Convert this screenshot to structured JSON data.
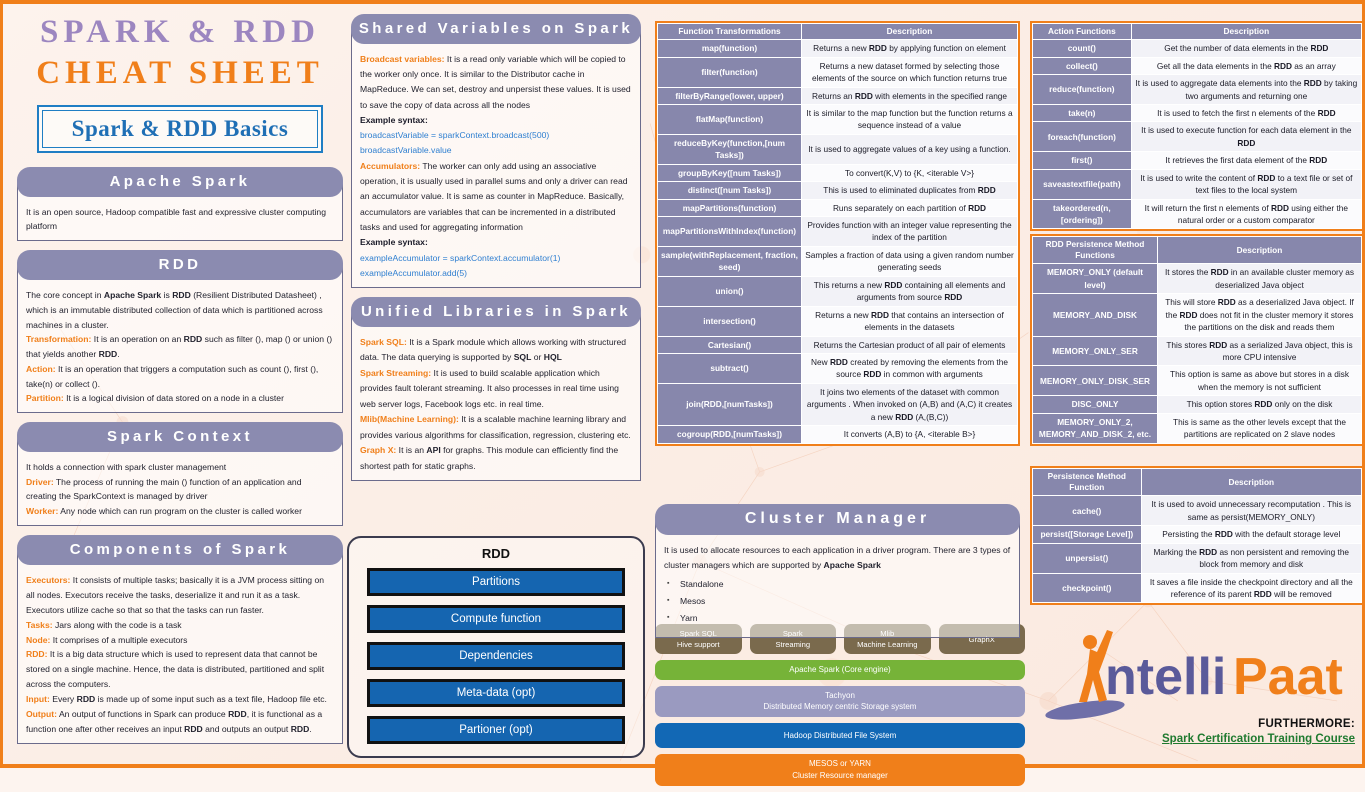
{
  "title": {
    "line1": "SPARK & RDD",
    "line2": "CHEAT SHEET",
    "badge": "Spark & RDD Basics"
  },
  "colors": {
    "accent_orange": "#F07F1A",
    "header_purple": "#8b8bb0",
    "title_purple": "#9c86c0",
    "badge_blue": "#1f6fb5",
    "bar_blue": "#1565b0"
  },
  "left": {
    "apache_spark": {
      "heading": "Apache Spark",
      "body": [
        {
          "text": "It is an open source, Hadoop compatible  fast and expressive cluster computing platform"
        }
      ]
    },
    "rdd": {
      "heading": "RDD",
      "body": [
        {
          "lead": "",
          "text": "The core concept in Apache Spark  is RDD (Resilient Distributed Datasheet) , which is an immutable  distributed collection of data which is partitioned across machines in a cluster."
        },
        {
          "lead": "Transformation:",
          "text": "  It is an operation  on an RDD such as filter (), map () or union () that yields another RDD."
        },
        {
          "lead": "Action:",
          "text": " It is an operation  that triggers a computation  such as count (), first (), take(n) or collect ()."
        },
        {
          "lead": "Partition:",
          "text": " It is a logical division of data stored on a node in a cluster"
        }
      ]
    },
    "spark_context": {
      "heading": "Spark Context",
      "body": [
        {
          "lead": "",
          "text": "It holds a connection with spark cluster management"
        },
        {
          "lead": "Driver:",
          "text": " The process of running the main () function of an application  and creating the SparkContext  is managed  by driver"
        },
        {
          "lead": "Worker:",
          "text": " Any node which can run program  on the cluster is called worker"
        }
      ]
    },
    "components": {
      "heading": "Components of Spark",
      "body": [
        {
          "lead": "Executors:",
          "text": " It consists of multiple  tasks; basically  it is a JVM process sitting on all nodes. Executors receive  the tasks, deserialize  it and run it as a task. Executors utilize  cache so that  so that  the tasks can run faster."
        },
        {
          "lead": "Tasks:",
          "text": " Jars along  with the code  is a task"
        },
        {
          "lead": "Node:",
          "text": " It comprises  of a multiple  executors"
        },
        {
          "lead": "RDD:",
          "text": " It is a big data  structure  which is used to represent data that cannot  be stored on a single machine.  Hence, the data  is distributed, partitioned  and split across  the computers."
        },
        {
          "lead": "Input:",
          "text": " Every RDD is made  up of some input such as  a text file, Hadoop  file etc."
        },
        {
          "lead": "Output:",
          "text": " An output  of functions in Spark  can produce  RDD, it is functional  as a function one after other receives an input RDD and outputs an output RDD."
        }
      ]
    }
  },
  "middle": {
    "shared_variables": {
      "heading": "Shared Variables on Spark",
      "body": [
        {
          "lead": "Broadcast  variables:",
          "text": "  It is a read only variable  which will be copied to the worker only once. It is similar  to the Distributor  cache in MapReduce. We can set, destroy and unpersist these values. It is used to save  the copy of data  across all the nodes"
        },
        {
          "bold": "Example  syntax:"
        },
        {
          "code": "broadcastVariable   = sparkContext.broadcast(500)"
        },
        {
          "code": "broadcastVariable.value"
        },
        {
          "lead": "Accumulators:",
          "text": " The worker can only add using an associative  operation, it is usually used in parallel sums and only a driver can read an accumulator value. It is same as counter in MapReduce. Basically,  accumulators  are variables  that can be incremented in a distributed tasks and used for aggregating  information"
        },
        {
          "bold": "Example  syntax:"
        },
        {
          "code": "exampleAccumulator   = sparkContext.accumulator(1)"
        },
        {
          "code": "exampleAccumulator.add(5)"
        }
      ]
    },
    "unified_libraries": {
      "heading": "Unified Libraries in Spark",
      "body": [
        {
          "lead": "Spark  SQL:",
          "text": " It is a Spark  module  which allows working with structured data.  The data querying  is supported by SQL or HQL"
        },
        {
          "lead": "Spark  Streaming:",
          "text": "  It is used to build scalable application  which provides fault tolerant  streaming.  It also processes in real time using web server logs, Facebook  logs etc. in real time."
        },
        {
          "lead": "Mlib(Machine  Learning):",
          "text": "  It is a scalable machine learning library and provides various algorithms  for classification, regression, clustering etc."
        },
        {
          "lead": "Graph X:",
          "text": " It is an API for graphs. This module  can efficiently find the shortest path for static graphs."
        }
      ]
    },
    "rdd_diagram": {
      "title": "RDD",
      "bars": [
        "Partitions",
        "Compute function",
        "Dependencies",
        "Meta-data (opt)",
        "Partioner (opt)"
      ]
    }
  },
  "transformations": {
    "headers": [
      "Function Transformations",
      "Description"
    ],
    "rows": [
      [
        "map(function)",
        "Returns a new RDD by applying function on element"
      ],
      [
        "filter(function)",
        "Returns a new dataset formed by selecting those elements  of the source on which function returns true"
      ],
      [
        "filterByRange(lower,  upper)",
        "Returns an RDD with elements  in the specified range"
      ],
      [
        "flatMap(function)",
        "It is similar to the map function but the function returns a sequence instead of a value"
      ],
      [
        "reduceByKey(function,[num Tasks])",
        "It is used to aggregate  values of a key using a function."
      ],
      [
        "groupByKey([num Tasks])",
        "To convert(K,V) to {K, <iterable  V>}"
      ],
      [
        "distinct([num Tasks])",
        "This is used to eliminated  duplicates from RDD"
      ],
      [
        "mapPartitions(function)",
        "Runs separately on each partition of RDD"
      ],
      [
        "mapPartitionsWithIndex(function)",
        "Provides function with an integer value representing the index of the partition"
      ],
      [
        "sample(withReplacement, fraction,  seed)",
        "Samples  a fraction of data using a given random number generating  seeds"
      ],
      [
        "union()",
        "This returns a new RDD containing all elements  and arguments  from source RDD"
      ],
      [
        "intersection()",
        "Returns a new RDD that contains an intersection of elements  in the datasets"
      ],
      [
        "Cartesian()",
        "Returns the Cartesian  product of all pair of elements"
      ],
      [
        "subtract()",
        "New RDD created  by removing the elements  from the source RDD in common  with arguments"
      ],
      [
        "join(RDD,[numTasks])",
        "It joins two elements  of the dataset  with common arguments . When invoked on (A,B) and (A,C)  it creates  a new RDD (A,(B,C))"
      ],
      [
        "cogroup(RDD,[numTasks])",
        "It converts (A,B) to {A, <iterable  B>}"
      ]
    ]
  },
  "cluster_manager": {
    "heading": "Cluster Manager",
    "intro": "It is used to allocate  resources to each application  in a driver program. There are 3 types of cluster managers  which are supported by Apache Spark",
    "intro_bold": "Apache Spark",
    "items": [
      "Standalone",
      "Mesos",
      "Yarn"
    ]
  },
  "spark_stack": {
    "top_row": [
      {
        "l1": "Spark SQL",
        "l2": "Hive support"
      },
      {
        "l1": "Spark",
        "l2": "Streaming"
      },
      {
        "l1": "Mlib",
        "l2": "Machine Learning"
      },
      {
        "l1": "GraphX",
        "l2": ""
      }
    ],
    "core": {
      "l1": "Apache Spark (Core engine)",
      "l2": ""
    },
    "tachyon": {
      "l1": "Tachyon",
      "l2": "Distributed Memory centric Storage system"
    },
    "hdfs": {
      "l1": "Hadoop Distributed File System",
      "l2": ""
    },
    "yarn": {
      "l1": "MESOS or YARN",
      "l2": "Cluster Resource  manager"
    }
  },
  "actions": {
    "headers": [
      "Action Functions",
      "Description"
    ],
    "rows": [
      [
        "count()",
        "Get the number of data elements in the RDD"
      ],
      [
        "collect()",
        "Get all the data elements in the RDD as an array"
      ],
      [
        "reduce(function)",
        "It is used to aggregate data  elements into the RDD by taking  two arguments  and returning one"
      ],
      [
        "take(n)",
        "It is used to fetch the  first n elements of the RDD"
      ],
      [
        "foreach(function)",
        "It is used to execute function for each data element in the RDD"
      ],
      [
        "first()",
        "It retrieves the first data  element of the RDD"
      ],
      [
        "saveastextfile(path)",
        "It is used to write the content of RDD to a text file or set of text files to the local system"
      ],
      [
        "takeordered(n, [ordering])",
        "It will return the first n elements of RDD using either the natural  order or a custom comparator"
      ]
    ]
  },
  "persistence_levels": {
    "headers": [
      "RDD Persistence Method Functions",
      "Description"
    ],
    "rows": [
      [
        "MEMORY_ONLY (default level)",
        "It stores the RDD in an available  cluster memory  as deserialized Java object"
      ],
      [
        "MEMORY_AND_DISK",
        "This will store RDD as a deserialized Java object. If the RDD does not fit in the cluster memory  it stores the partitions on the disk and reads them"
      ],
      [
        "MEMORY_ONLY_SER",
        "This stores RDD as a serialized  Java object, this is more CPU intensive"
      ],
      [
        "MEMORY_ONLY_DISK_SER",
        "This option is same as above  but stores in a disk when the memory  is not sufficient"
      ],
      [
        "DISC_ONLY",
        "This option stores RDD only on the disk"
      ],
      [
        "MEMORY_ONLY_2, MEMORY_AND_DISK_2, etc.",
        "This is same as the other levels except that the partitions  are replicated  on 2 slave nodes"
      ]
    ]
  },
  "persistence_methods": {
    "headers": [
      "Persistence Method Function",
      "Description"
    ],
    "rows": [
      [
        "cache()",
        "It is used to avoid unnecessary recomputation  . This is same as persist(MEMORY_ONLY)"
      ],
      [
        "persist([Storage  Level])",
        "Persisting the RDD with the default storage level"
      ],
      [
        "unpersist()",
        "Marking the RDD as non persistent and removing the block from memory and disk"
      ],
      [
        "checkpoint()",
        "It saves a file inside the checkpoint directory and all the reference of its parent RDD will be removed"
      ]
    ]
  },
  "footer": {
    "brand": "IntelliPaat",
    "brand_part1": "ntelli",
    "brand_part2": "Paat",
    "furthermore_label": "FURTHERMORE:",
    "course_link": "Spark Certification  Training Course"
  }
}
